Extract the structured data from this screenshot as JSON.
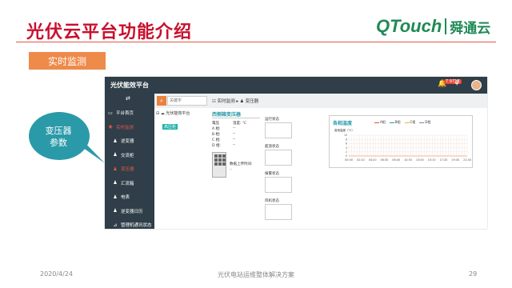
{
  "slide": {
    "title": "光伏云平台功能介绍",
    "logo_q": "QTouch",
    "logo_cn": "舜通云",
    "tag": "实时监测",
    "callout_line1": "变压器",
    "callout_line2": "参数"
  },
  "app": {
    "title": "光伏能效平台",
    "badge": "7 9718",
    "search_placeholder": "关键字",
    "breadcrumb": "☷ 实时监测 ▸ ♟ 变压器",
    "sidebar": [
      {
        "label": "平台首页",
        "icon": "monitor-icon",
        "glyph": "▭",
        "active": false
      },
      {
        "label": "实时监测",
        "icon": "target-icon",
        "glyph": "◉",
        "active": true
      },
      {
        "label": "逆变器",
        "icon": "person-icon",
        "glyph": "♟",
        "active": false,
        "sub": true
      },
      {
        "label": "交流柜",
        "icon": "person-icon",
        "glyph": "♟",
        "active": false,
        "sub": true
      },
      {
        "label": "变压器",
        "icon": "person-icon",
        "glyph": "♟",
        "active": true,
        "sub": true
      },
      {
        "label": "汇流箱",
        "icon": "person-icon",
        "glyph": "♟",
        "active": false,
        "sub": true
      },
      {
        "label": "电表",
        "icon": "person-icon",
        "glyph": "♟",
        "active": false,
        "sub": true
      },
      {
        "label": "逆变器日历",
        "icon": "person-icon",
        "glyph": "♟",
        "active": false,
        "sub": true
      },
      {
        "label": "管理机通讯状态",
        "icon": "signal-icon",
        "glyph": "⊿",
        "active": false,
        "sub": true
      }
    ],
    "tree": {
      "root": "光伏能效平台",
      "node": "高压柜"
    },
    "device": {
      "title": "西侧箱变压器",
      "col1_header": "電压",
      "col2_header": "温度: ℃",
      "rows": [
        {
          "label": "A 相:",
          "value": "--"
        },
        {
          "label": "B 相:",
          "value": "--"
        },
        {
          "label": "C 相:",
          "value": "--"
        },
        {
          "label": "D 相:",
          "value": "--"
        }
      ],
      "upload_label": "数据上传时间:",
      "upload_value": "--"
    },
    "status_boxes": [
      {
        "label": "运行状态"
      },
      {
        "label": "超温状态"
      },
      {
        "label": "报警状态"
      },
      {
        "label": "风机状态"
      }
    ],
    "temp_chart": {
      "title": "各相温度",
      "legend": [
        "A相",
        "B相",
        "C相",
        "D相"
      ],
      "legend_colors": [
        "#e84a3a",
        "#2a9aa8",
        "#f0b030",
        "#a070c0"
      ],
      "ylabel": "各相温度（℃）",
      "yticks": [
        "10",
        "8",
        "6",
        "4",
        "2",
        "0"
      ],
      "xticks": [
        "00:00",
        "02:10",
        "04:20",
        "06:30",
        "08:40",
        "10:50",
        "13:00",
        "15:10",
        "17:20",
        "19:30",
        "21:40"
      ],
      "line_color": "#f0a070"
    }
  },
  "footer": {
    "date": "2020/4/24",
    "center": "光伏电站运维整体解决方案",
    "page": "29"
  },
  "chart_data": {
    "type": "line",
    "title": "各相温度",
    "ylabel": "各相温度（℃）",
    "xlabel": "",
    "categories": [
      "00:00",
      "02:10",
      "04:20",
      "06:30",
      "08:40",
      "10:50",
      "13:00",
      "15:10",
      "17:20",
      "19:30",
      "21:40"
    ],
    "series": [
      {
        "name": "A相",
        "values": [
          0,
          0,
          0,
          0,
          0,
          0,
          0,
          0,
          0,
          0,
          0
        ]
      }
    ],
    "ylim": [
      0,
      10
    ],
    "grid": true,
    "legend": "top"
  }
}
